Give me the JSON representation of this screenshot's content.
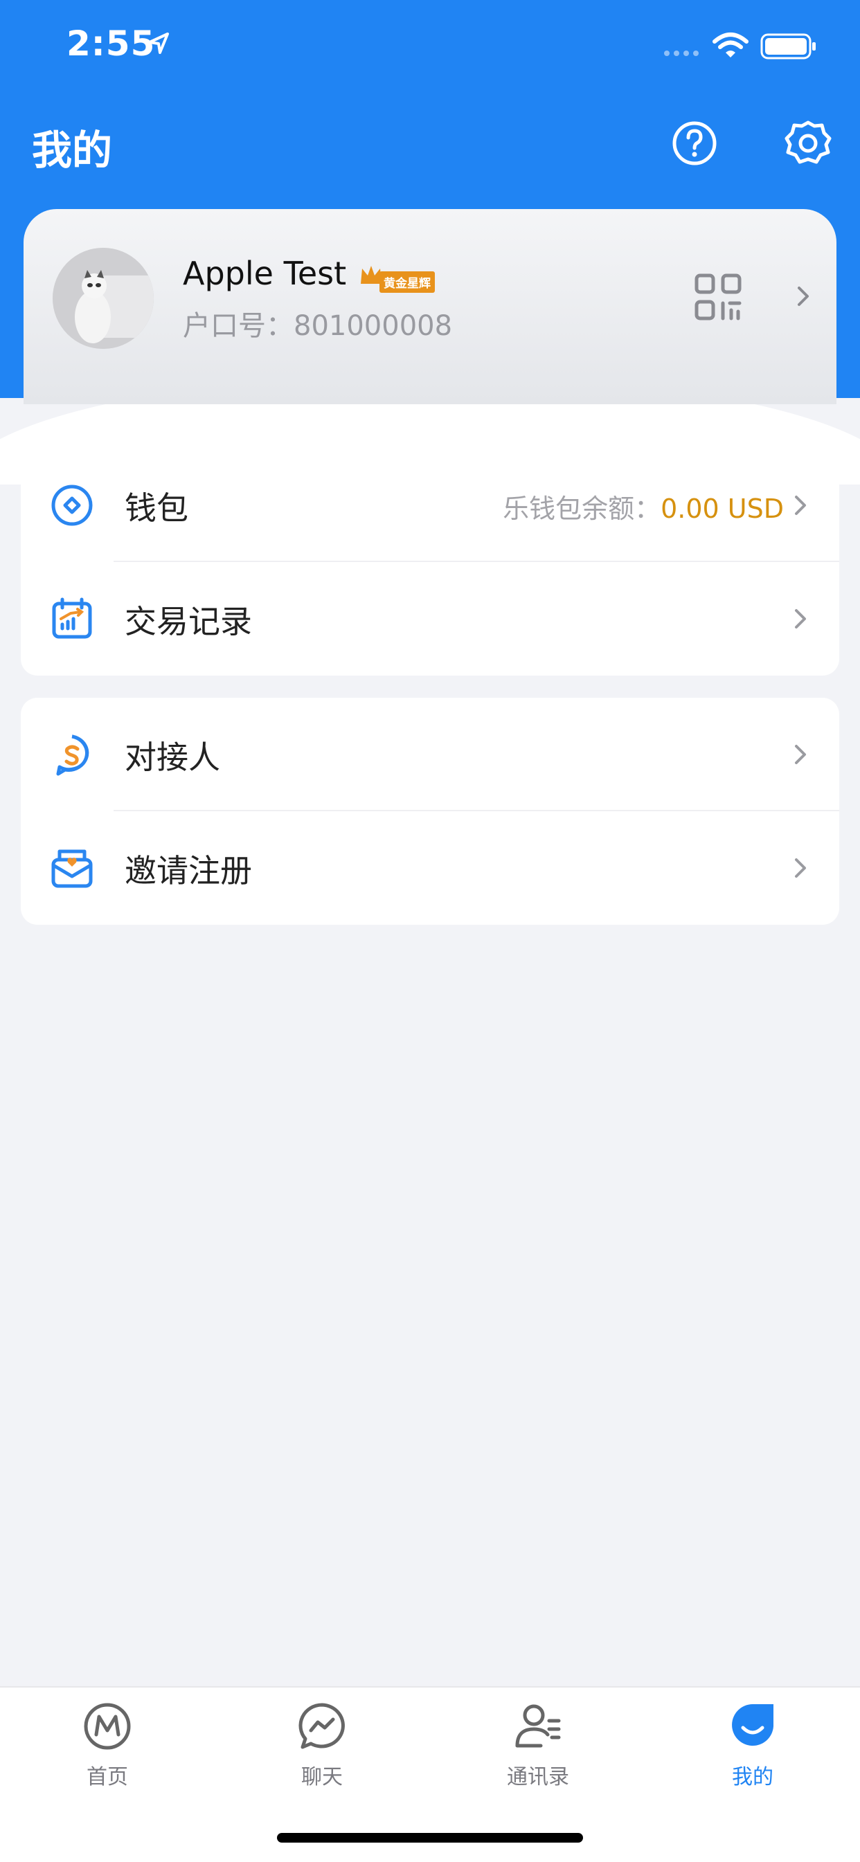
{
  "status_bar": {
    "time": "2:55"
  },
  "header": {
    "title": "我的"
  },
  "profile": {
    "name": "Apple Test",
    "badge": "黄金星辉",
    "account_label": "户口号：",
    "account_number": "801000008"
  },
  "menu_groups": [
    {
      "items": [
        {
          "label": "钱包",
          "info_label": "乐钱包余额：",
          "info_value": "0.00 USD"
        },
        {
          "label": "交易记录"
        }
      ]
    },
    {
      "items": [
        {
          "label": "对接人"
        },
        {
          "label": "邀请注册"
        }
      ]
    }
  ],
  "tabbar": [
    {
      "label": "首页",
      "active": false
    },
    {
      "label": "聊天",
      "active": false
    },
    {
      "label": "通讯录",
      "active": false
    },
    {
      "label": "我的",
      "active": true
    }
  ],
  "colors": {
    "brand_blue": "#2084f3",
    "balance_gold": "#d6910f"
  }
}
